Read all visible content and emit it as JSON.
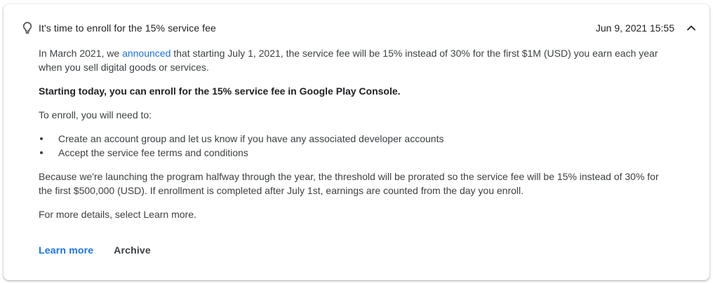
{
  "notification": {
    "title": "It's time to enroll for the 15% service fee",
    "timestamp": "Jun 9, 2021 15:55",
    "icon": "lightbulb-icon",
    "collapse_icon": "chevron-up-icon"
  },
  "body": {
    "para1_before": "In March 2021, we ",
    "para1_link": "announced",
    "para1_after": " that starting July 1, 2021, the service fee will be 15% instead of 30% for the first $1M (USD) you earn each year when you sell digital goods or services.",
    "para2": "Starting today, you can enroll for the 15% service fee in Google Play Console.",
    "para3": "To enroll, you will need to:",
    "bullets": [
      "Create an account group and let us know if you have any associated developer accounts",
      "Accept the service fee terms and conditions"
    ],
    "para4": "Because we're launching the program halfway through the year, the threshold will be prorated so the service fee will be 15% instead of 30% for the first $500,000 (USD). If enrollment is completed after July 1st, earnings are counted from the day you enroll.",
    "para5": "For more details, select Learn more."
  },
  "actions": {
    "learn_more": "Learn more",
    "archive": "Archive"
  },
  "colors": {
    "link": "#1a73e8",
    "text": "#3c4043",
    "title": "#202124"
  }
}
